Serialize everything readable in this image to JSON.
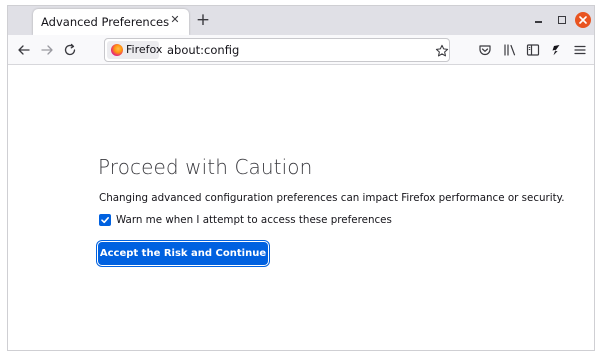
{
  "tab": {
    "title": "Advanced Preferences",
    "close_glyph": "✕",
    "new_tab_glyph": "+"
  },
  "window_controls": {
    "minimize": "minimize-icon",
    "maximize": "maximize-icon",
    "close": "close-icon"
  },
  "navbar": {
    "identity_label": "Firefox",
    "url": "about:config",
    "icons": [
      "back-arrow-icon",
      "forward-arrow-icon",
      "reload-icon",
      "bookmark-star-icon",
      "pocket-icon",
      "library-icon",
      "sidebar-icon",
      "extension-icon",
      "menu-icon"
    ]
  },
  "content": {
    "title": "Proceed with Caution",
    "description": "Changing advanced configuration preferences can impact Firefox performance or security.",
    "warn_checkbox": {
      "label": "Warn me when I attempt to access these preferences",
      "checked": true
    },
    "accept_button": "Accept the Risk and Continue"
  },
  "colors": {
    "accent": "#0061e0",
    "close_button": "#e95420",
    "tabbar": "#e0e0e6"
  }
}
